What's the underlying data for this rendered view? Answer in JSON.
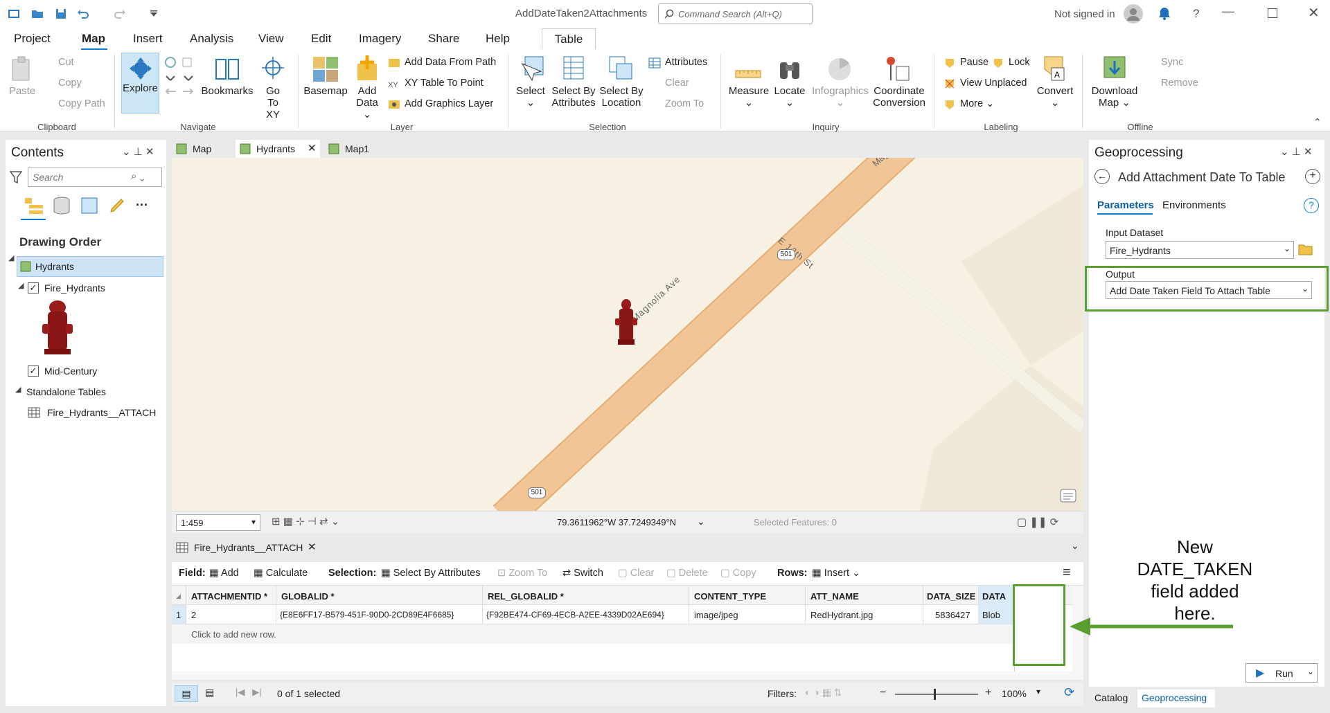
{
  "app": {
    "title": "AddDateTaken2Attachments",
    "search_placeholder": "Command Search (Alt+Q)",
    "user_status": "Not signed in"
  },
  "tabs": [
    "Project",
    "Map",
    "Insert",
    "Analysis",
    "View",
    "Edit",
    "Imagery",
    "Share",
    "Help",
    "Table"
  ],
  "ribbon": {
    "clipboard": {
      "label": "Clipboard",
      "paste": "Paste",
      "cut": "Cut",
      "copy": "Copy",
      "copy_path": "Copy Path"
    },
    "navigate": {
      "label": "Navigate",
      "explore": "Explore",
      "bookmarks": "Bookmarks",
      "go": "Go",
      "to_xy": "To XY"
    },
    "layer": {
      "label": "Layer",
      "basemap": "Basemap",
      "add": "Add",
      "data": "Data",
      "add_data_from_path": "Add Data From Path",
      "xy_table": "XY Table To Point",
      "add_graphics": "Add Graphics Layer"
    },
    "selection": {
      "label": "Selection",
      "select": "Select",
      "select_by": "Select By",
      "attributes": "Attributes",
      "location": "Location",
      "attributes_btn": "Attributes",
      "clear": "Clear",
      "zoom_to": "Zoom To"
    },
    "inquiry": {
      "label": "Inquiry",
      "measure": "Measure",
      "locate": "Locate",
      "infographics": "Infographics",
      "coordinate": "Coordinate",
      "conversion": "Conversion"
    },
    "labeling": {
      "label": "Labeling",
      "pause": "Pause",
      "lock": "Lock",
      "view_unplaced": "View Unplaced",
      "more": "More",
      "convert": "Convert"
    },
    "offline": {
      "label": "Offline",
      "download": "Download",
      "map": "Map",
      "sync": "Sync",
      "remove": "Remove"
    }
  },
  "contents": {
    "title": "Contents",
    "search_placeholder": "Search",
    "drawing_order": "Drawing Order",
    "map_name": "Hydrants",
    "layer1": "Fire_Hydrants",
    "layer2": "Mid-Century",
    "standalone": "Standalone Tables",
    "table1": "Fire_Hydrants__ATTACH"
  },
  "map_tabs": [
    "Map",
    "Hydrants",
    "Map1"
  ],
  "map_labels": {
    "road_main": "Magnolia Ave",
    "road_top": "Mag",
    "route1": "501",
    "route2": "501",
    "street": "E 12th St"
  },
  "map_status": {
    "scale": "1:459",
    "coords": "79.3611962°W 37.7249349°N",
    "selected": "Selected Features: 0"
  },
  "table": {
    "tab": "Fire_Hydrants__ATTACH",
    "toolbar": {
      "field": "Field:",
      "add": "Add",
      "calculate": "Calculate",
      "selection": "Selection:",
      "select_by_attr": "Select By Attributes",
      "zoom_to": "Zoom To",
      "switch": "Switch",
      "clear": "Clear",
      "delete": "Delete",
      "copy": "Copy",
      "rows": "Rows:",
      "insert": "Insert"
    },
    "columns": [
      "ATTACHMENTID *",
      "GLOBALID *",
      "REL_GLOBALID *",
      "CONTENT_TYPE",
      "ATT_NAME",
      "DATA_SIZE",
      "DATA"
    ],
    "rows": [
      {
        "num": "1",
        "cells": [
          "2",
          "{E8E6FF17-B579-451F-90D0-2CD89E4F6685}",
          "{F92BE474-CF69-4ECB-A2EE-4339D02AE694}",
          "image/jpeg",
          "RedHydrant.jpg",
          "5836427",
          "Blob"
        ]
      }
    ],
    "add_row": "Click to add new row.",
    "status": {
      "selected": "0 of 1 selected",
      "filters": "Filters:",
      "zoom": "100%"
    }
  },
  "geoprocessing": {
    "title": "Geoprocessing",
    "tool": "Add Attachment Date To Table",
    "tab_params": "Parameters",
    "tab_env": "Environments",
    "input_label": "Input Dataset",
    "input_value": "Fire_Hydrants",
    "output_label": "Output",
    "output_value": "Add Date Taken Field To Attach Table",
    "run": "Run"
  },
  "annotation": {
    "line1": "New",
    "line2": "DATE_TAKEN",
    "line3": "field added",
    "line4": "here."
  },
  "bottom_tabs": [
    "Catalog",
    "Geoprocessing"
  ],
  "colors": {
    "accent": "#0a7ed6",
    "highlight_green": "#5a9e2f",
    "hydrant": "#9b1c1c",
    "road": "#f2c596",
    "selected": "#cfe3f6"
  }
}
